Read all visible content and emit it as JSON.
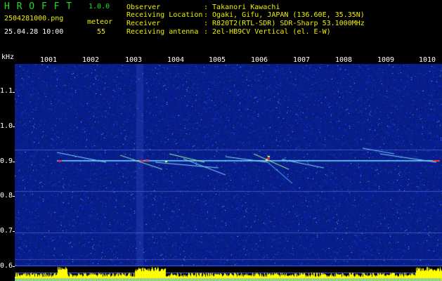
{
  "header": {
    "app_title": "H R O F F T",
    "version": "1.0.0",
    "filename": "2504281000.png",
    "datetime": "25.04.28 10:00",
    "meteor_label": "meteor",
    "meteor_count": "55",
    "info_labels": [
      "Observer",
      "Receiving Location",
      "Receiver",
      "Receiving antenna"
    ],
    "info_values": [
      ": Takanori Kawachi",
      ": Ogaki, Gifu, JAPAN (136.60E, 35.35N)",
      ": R820T2(RTL-SDR) SDR-Sharp 53.1000MHz",
      ": 2el-HB9CV Vertical (el. E-W)"
    ]
  },
  "axis": {
    "y_unit": "kHz",
    "y_ticks": [
      "1.1",
      "1.0",
      "0.9",
      "0.8",
      "0.7",
      "0.6"
    ],
    "x_ticks": [
      "1001",
      "1002",
      "1003",
      "1004",
      "1005",
      "1006",
      "1007",
      "1008",
      "1009",
      "1010"
    ]
  },
  "colors": {
    "background": "#000000",
    "spectrogram_base": "#0a1ea0",
    "signal_line": "#66ccff",
    "meteor_hot": "#ff3344",
    "histogram": "#ffff00",
    "label_green": "#22dd22",
    "label_yellow": "#f0f000"
  }
}
